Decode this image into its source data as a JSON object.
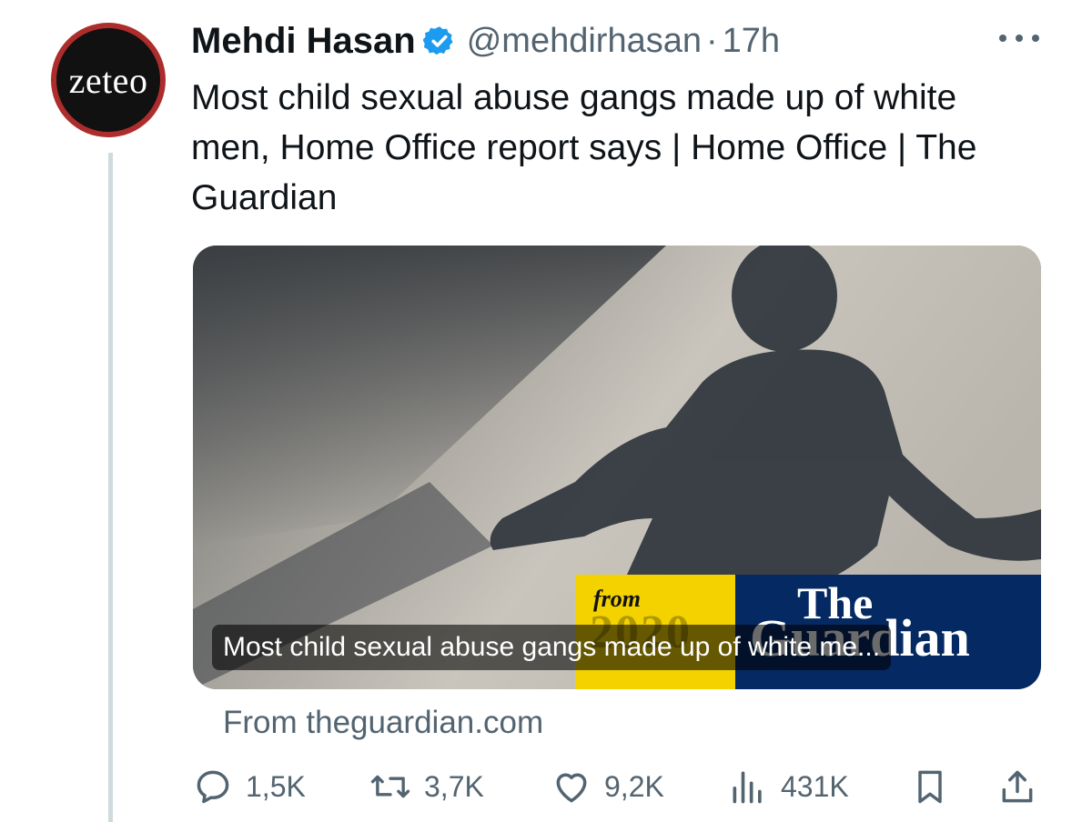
{
  "account": {
    "avatar_text": "zeteo",
    "name": "Mehdi Hasan",
    "handle": "@mehdirhasan",
    "separator": "·",
    "time": "17h"
  },
  "tweet": {
    "text": "Most child sexual abuse gangs made up of white men, Home Office report says | Home Office | The Guardian"
  },
  "card": {
    "caption": "Most child sexual abuse gangs made up of white me...",
    "source": "From theguardian.com",
    "brand_from": "from",
    "brand_year": "2020",
    "brand_the": "The",
    "brand_name": "Guardian"
  },
  "actions": {
    "replies": "1,5K",
    "retweets": "3,7K",
    "likes": "9,2K",
    "views": "431K"
  },
  "icons": [
    "verified-icon",
    "more-icon",
    "reply-icon",
    "retweet-icon",
    "like-icon",
    "views-icon",
    "bookmark-icon",
    "share-icon"
  ],
  "colors": {
    "accent": "#1d9bf0",
    "text": "#0f1419",
    "muted": "#536471",
    "guardian_blue": "#052962",
    "guardian_yellow": "#f3d200",
    "avatar_ring": "#ad2c2c"
  }
}
